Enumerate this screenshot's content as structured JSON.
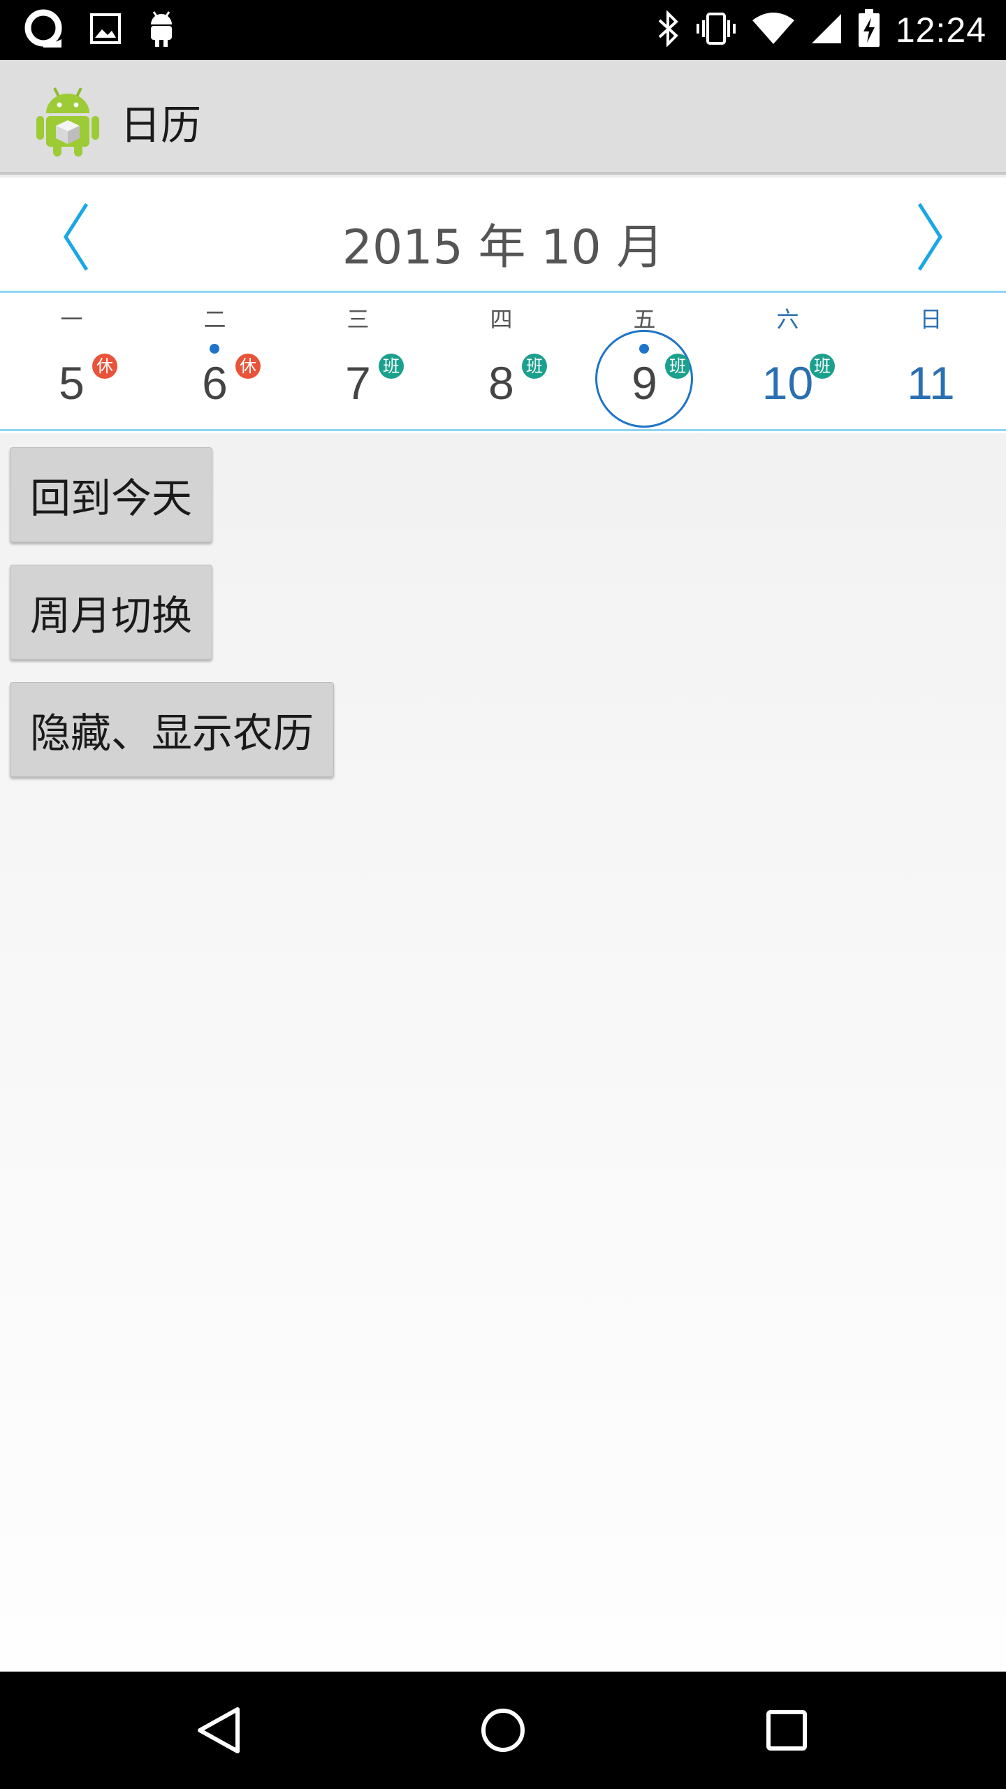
{
  "status_bar": {
    "time": "12:24",
    "left_icons": [
      "app-notification-icon",
      "image-icon",
      "android-icon"
    ],
    "right_icons": [
      "bluetooth-icon",
      "vibrate-icon",
      "wifi-icon",
      "signal-icon",
      "battery-charging-icon"
    ]
  },
  "action_bar": {
    "title": "日历",
    "icon": "android-app-icon"
  },
  "calendar": {
    "month_title": "2015 年 10 月",
    "prev_icon": "chevron-left-icon",
    "next_icon": "chevron-right-icon",
    "accent_color": "#1e74c8",
    "days": [
      {
        "weekday": "一",
        "day": "5",
        "badge": "休",
        "badge_type": "rest",
        "event_dot": false,
        "today": false,
        "weekend": false
      },
      {
        "weekday": "二",
        "day": "6",
        "badge": "休",
        "badge_type": "rest",
        "event_dot": true,
        "today": false,
        "weekend": false
      },
      {
        "weekday": "三",
        "day": "7",
        "badge": "班",
        "badge_type": "work",
        "event_dot": false,
        "today": false,
        "weekend": false
      },
      {
        "weekday": "四",
        "day": "8",
        "badge": "班",
        "badge_type": "work",
        "event_dot": false,
        "today": false,
        "weekend": false
      },
      {
        "weekday": "五",
        "day": "9",
        "badge": "班",
        "badge_type": "work",
        "event_dot": true,
        "today": true,
        "weekend": false
      },
      {
        "weekday": "六",
        "day": "10",
        "badge": "班",
        "badge_type": "work",
        "event_dot": false,
        "today": false,
        "weekend": true
      },
      {
        "weekday": "日",
        "day": "11",
        "badge": "",
        "badge_type": "",
        "event_dot": false,
        "today": false,
        "weekend": true
      }
    ]
  },
  "buttons": {
    "back_to_today": "回到今天",
    "toggle_week_month": "周月切换",
    "toggle_lunar": "隐藏、显示农历"
  },
  "nav_bar": {
    "icons": [
      "back-icon",
      "home-icon",
      "recents-icon"
    ]
  }
}
